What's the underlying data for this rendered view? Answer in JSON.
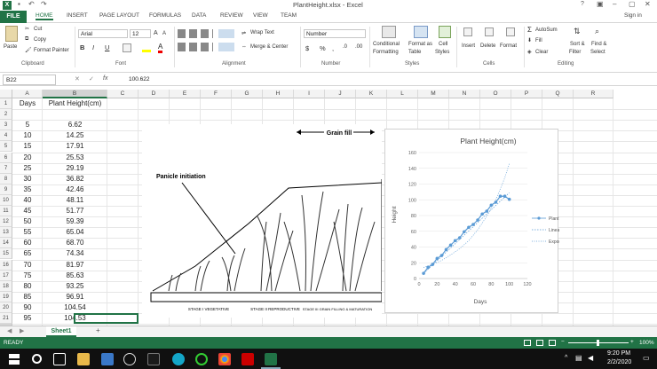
{
  "app": {
    "title": "PlantHeight.xlsx - Excel",
    "signin": "Sign in",
    "help": "?",
    "colors": {
      "accent": "#217346",
      "chart_series": "#5b9bd5"
    }
  },
  "tabs": [
    "FILE",
    "HOME",
    "INSERT",
    "PAGE LAYOUT",
    "FORMULAS",
    "DATA",
    "REVIEW",
    "VIEW",
    "TEAM"
  ],
  "ribbon": {
    "clipboard": {
      "paste": "Paste",
      "cut": "Cut",
      "copy": "Copy",
      "format_painter": "Format Painter",
      "label": "Clipboard"
    },
    "font": {
      "name": "Arial",
      "size": "12",
      "label": "Font",
      "bold": "B",
      "italic": "I",
      "underline": "U"
    },
    "alignment": {
      "wrap": "Wrap Text",
      "merge": "Merge & Center",
      "label": "Alignment"
    },
    "number": {
      "format": "Number",
      "label": "Number",
      "currency": "$",
      "percent": "%",
      "comma": ","
    },
    "styles": {
      "conditional": "Conditional",
      "conditional2": "Formatting",
      "format_as": "Format as",
      "format_as2": "Table",
      "cell_styles": "Cell",
      "cell_styles2": "Styles",
      "label": "Styles"
    },
    "cells": {
      "insert": "Insert",
      "delete": "Delete",
      "format": "Format",
      "label": "Cells"
    },
    "editing": {
      "autosum": "AutoSum",
      "fill": "Fill",
      "clear": "Clear",
      "sort": "Sort &",
      "sort2": "Filter",
      "find": "Find &",
      "find2": "Select",
      "label": "Editing"
    }
  },
  "formula_bar": {
    "cell_ref": "B22",
    "fx": "fx",
    "value": "100.622"
  },
  "columns": [
    "A",
    "B",
    "C",
    "D",
    "E",
    "F",
    "G",
    "H",
    "I",
    "J",
    "K",
    "L",
    "M",
    "N",
    "O",
    "P",
    "Q",
    "R"
  ],
  "rows": [
    "1",
    "2",
    "3",
    "4",
    "5",
    "6",
    "7",
    "8",
    "9",
    "10",
    "11",
    "12",
    "13",
    "14",
    "15",
    "16",
    "17",
    "18",
    "19",
    "20",
    "21",
    "22"
  ],
  "table": {
    "headers": [
      "Days",
      "Plant Height(cm)"
    ],
    "data": [
      [
        "5",
        "6.62"
      ],
      [
        "10",
        "14.25"
      ],
      [
        "15",
        "17.91"
      ],
      [
        "20",
        "25.53"
      ],
      [
        "25",
        "29.19"
      ],
      [
        "30",
        "36.82"
      ],
      [
        "35",
        "42.46"
      ],
      [
        "40",
        "48.11"
      ],
      [
        "45",
        "51.77"
      ],
      [
        "50",
        "59.39"
      ],
      [
        "55",
        "65.04"
      ],
      [
        "60",
        "68.70"
      ],
      [
        "65",
        "74.34"
      ],
      [
        "70",
        "81.97"
      ],
      [
        "75",
        "85.63"
      ],
      [
        "80",
        "93.25"
      ],
      [
        "85",
        "96.91"
      ],
      [
        "90",
        "104.54"
      ],
      [
        "95",
        "104.53"
      ],
      [
        "100",
        "100.62"
      ]
    ]
  },
  "diagram": {
    "grain_fill": "Grain fill",
    "panicle": "Panicle initiation",
    "stages": [
      "STAGE I VEGETATIVE",
      "STAGE II REPRODUCTIVE",
      "STAGE III GRAIN FILLING & MATURATION"
    ]
  },
  "chart_data": {
    "type": "scatter",
    "title": "Plant Height(cm)",
    "xlabel": "Days",
    "ylabel": "Height",
    "xlim": [
      0,
      120
    ],
    "ylim": [
      0,
      160
    ],
    "xticks": [
      0,
      20,
      40,
      60,
      80,
      100,
      120
    ],
    "yticks": [
      0,
      20,
      40,
      60,
      80,
      100,
      120,
      140,
      160
    ],
    "grid": true,
    "legend_position": "right",
    "series": [
      {
        "name": "Plant Height(cm)",
        "x": [
          5,
          10,
          15,
          20,
          25,
          30,
          35,
          40,
          45,
          50,
          55,
          60,
          65,
          70,
          75,
          80,
          85,
          90,
          95,
          100
        ],
        "y": [
          6.62,
          14.25,
          17.91,
          25.53,
          29.19,
          36.82,
          42.46,
          48.11,
          51.77,
          59.39,
          65.04,
          68.7,
          74.34,
          81.97,
          85.63,
          93.25,
          96.91,
          104.54,
          104.53,
          100.62
        ]
      },
      {
        "name": "Linear (Plant Height(cm))",
        "x": [
          5,
          100
        ],
        "y": [
          6.4,
          109
        ]
      },
      {
        "name": "Expon. (Plant Height(cm))",
        "x": [
          5,
          15,
          25,
          35,
          45,
          55,
          65,
          75,
          85,
          95,
          100
        ],
        "y": [
          14,
          18,
          23,
          30,
          38,
          48,
          62,
          79,
          100,
          128,
          146
        ]
      }
    ]
  },
  "sheet": {
    "name": "Sheet1",
    "add": "+"
  },
  "status": {
    "ready": "READY",
    "zoom": "100%"
  },
  "taskbar": {
    "time": "9:20 PM",
    "date": "2/2/2020"
  }
}
